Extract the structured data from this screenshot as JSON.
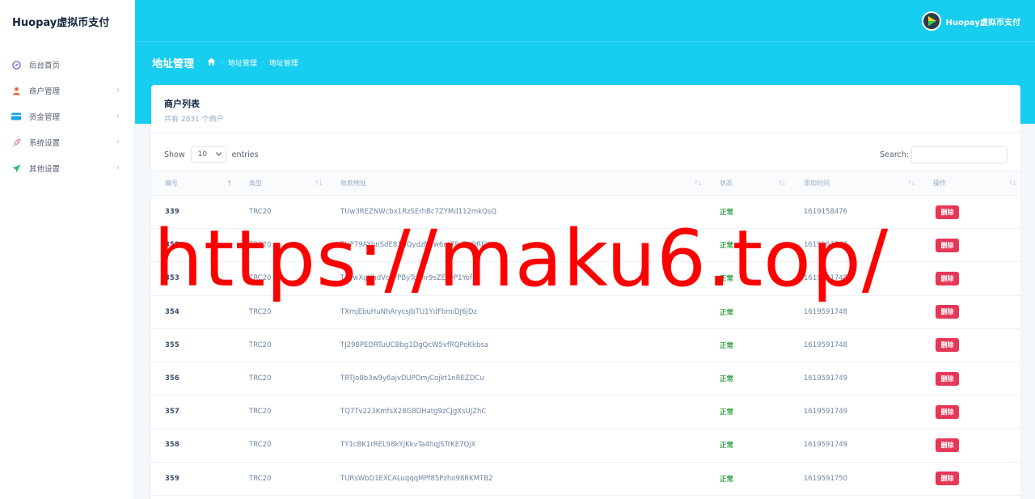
{
  "brand": "Huopay虚拟币支付",
  "sidebar": {
    "items": [
      {
        "label": "后台首页",
        "icon": "compass-icon",
        "has_arrow": false
      },
      {
        "label": "商户管理",
        "icon": "user-icon",
        "has_arrow": true
      },
      {
        "label": "资金管理",
        "icon": "credit-card-icon",
        "has_arrow": true
      },
      {
        "label": "系统设置",
        "icon": "rocket-icon",
        "has_arrow": true
      },
      {
        "label": "其他设置",
        "icon": "send-icon",
        "has_arrow": true
      }
    ]
  },
  "header": {
    "user_name": "Huopay虚拟币支付",
    "page_title": "地址管理",
    "breadcrumb": [
      "地址管理",
      "地址管理"
    ]
  },
  "card": {
    "title": "商户列表",
    "subtitle": "共有 2831 个商户"
  },
  "controls": {
    "show_label": "Show",
    "entries_value": "10",
    "entries_label": "entries",
    "search_label": "Search:",
    "search_value": ""
  },
  "table": {
    "columns": [
      "编号",
      "类型",
      "收款地址",
      "状态",
      "添加时间",
      "操作"
    ],
    "rows": [
      {
        "id": "339",
        "type": "TRC20",
        "address": "TUw3REZNWcbx1RzSErhBc7ZYMd112mkQsQ",
        "status": "正常",
        "time": "1619158476",
        "action": "删除"
      },
      {
        "id": "352",
        "type": "TRC20",
        "address": "THP79AYbnSdE81UQydzNYw6nt7FcTqDRFX",
        "status": "正常",
        "time": "1619591747",
        "action": "删除"
      },
      {
        "id": "353",
        "type": "TRC20",
        "address": "TQrwXgXhdVcLFPByTc2hr9sZEyvP1Yof",
        "status": "正常",
        "time": "1619591748",
        "action": "删除"
      },
      {
        "id": "354",
        "type": "TRC20",
        "address": "TXmjEbuHuNhArycsJbTU1YdFbmiDJ6jDz",
        "status": "正常",
        "time": "1619591748",
        "action": "删除"
      },
      {
        "id": "355",
        "type": "TRC20",
        "address": "TJ298PEDRTuUCBbg1DgQcW5vfRQPoKkbsa",
        "status": "正常",
        "time": "1619591748",
        "action": "删除"
      },
      {
        "id": "356",
        "type": "TRC20",
        "address": "TRTJo8b3w9y6ajvDUPDmjCojkt1nREZDCu",
        "status": "正常",
        "time": "1619591749",
        "action": "删除"
      },
      {
        "id": "357",
        "type": "TRC20",
        "address": "TQ7Tv223KmfsX28G8DHatg9zCJgXsUJZhC",
        "status": "正常",
        "time": "1619591749",
        "action": "删除"
      },
      {
        "id": "358",
        "type": "TRC20",
        "address": "TY1cBK1rREL98kYjKkvTa4hqJSTrKE7QjX",
        "status": "正常",
        "time": "1619591749",
        "action": "删除"
      },
      {
        "id": "359",
        "type": "TRC20",
        "address": "TURsWbD1EXCALuqqqMPf85Pzho98RKMTB2",
        "status": "正常",
        "time": "1619591750",
        "action": "删除"
      }
    ]
  },
  "watermark": "https://maku6.top/",
  "colors": {
    "header": "#17cdf0",
    "status_ok": "#2e9f3e",
    "delete": "#e63757"
  }
}
